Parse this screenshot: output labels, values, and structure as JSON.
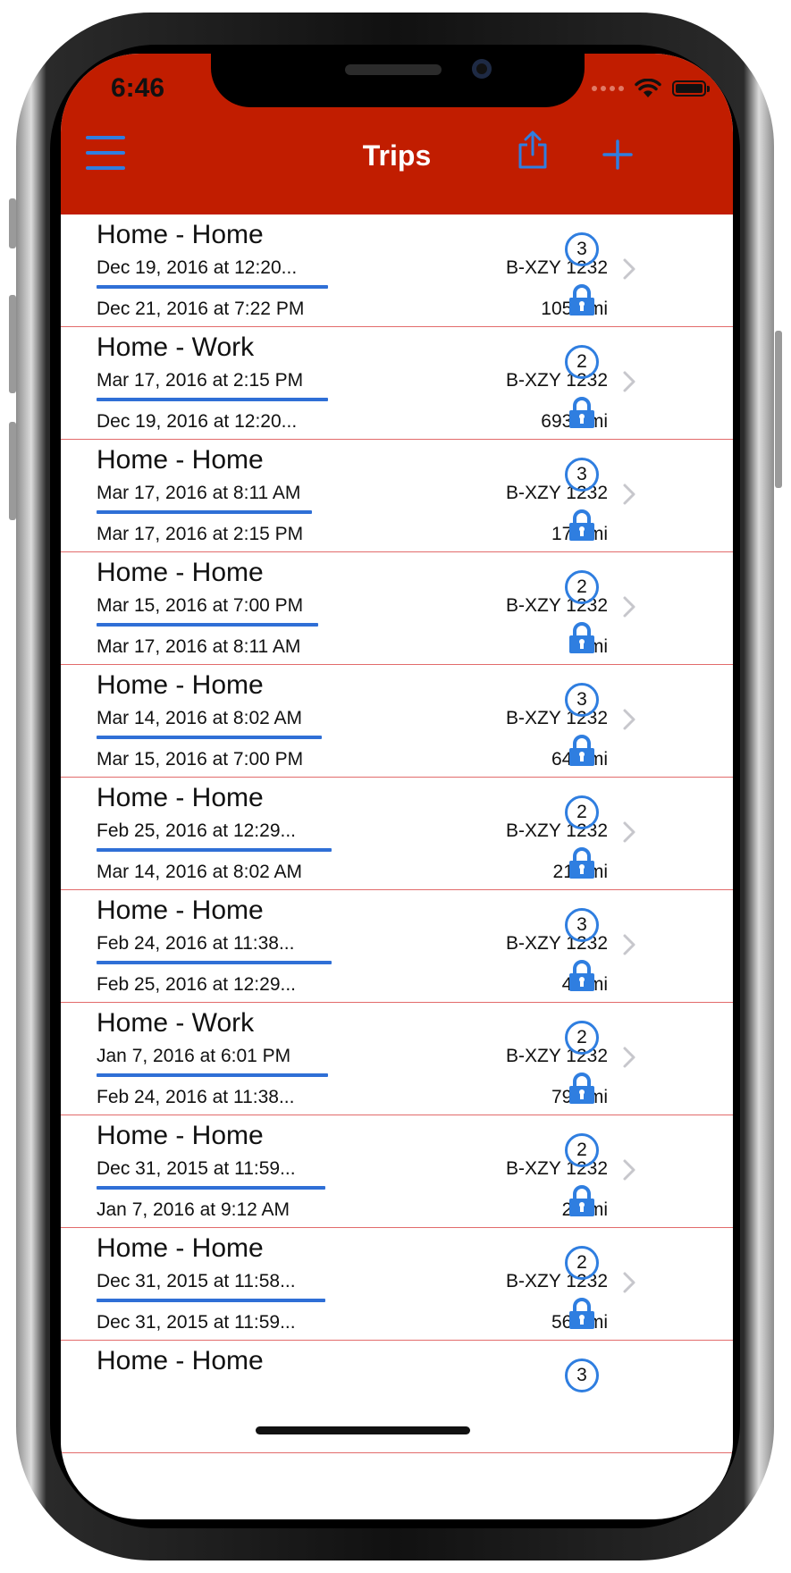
{
  "status_bar": {
    "time": "6:46"
  },
  "nav": {
    "title": "Trips",
    "menu_icon": "hamburger-icon",
    "share_icon": "share-icon",
    "add_icon": "plus-icon"
  },
  "colors": {
    "header": "#c11d00",
    "accent": "#2f7ee0",
    "divider": "#e26b6b"
  },
  "trips": [
    {
      "title": "Home - Home",
      "start": "Dec 19, 2016 at 12:20...",
      "end": "Dec 21, 2016 at 7:22 PM",
      "plate": "B-XZY 1232",
      "distance": "1054 mi",
      "count": "3",
      "progress": 0.72
    },
    {
      "title": "Home - Work",
      "start": "Mar 17, 2016 at 2:15 PM",
      "end": "Dec 19, 2016 at 12:20...",
      "plate": "B-XZY 1232",
      "distance": "6931 mi",
      "count": "2",
      "progress": 0.72
    },
    {
      "title": "Home - Home",
      "start": "Mar 17, 2016 at 8:11 AM",
      "end": "Mar 17, 2016 at 2:15 PM",
      "plate": "B-XZY 1232",
      "distance": "173 mi",
      "count": "3",
      "progress": 0.67
    },
    {
      "title": "Home - Home",
      "start": "Mar 15, 2016 at 7:00 PM",
      "end": "Mar 17, 2016 at 8:11 AM",
      "plate": "B-XZY 1232",
      "distance": "3 mi",
      "count": "2",
      "progress": 0.69
    },
    {
      "title": "Home - Home",
      "start": "Mar 14, 2016 at 8:02 AM",
      "end": "Mar 15, 2016 at 7:00 PM",
      "plate": "B-XZY 1232",
      "distance": "648 mi",
      "count": "3",
      "progress": 0.7
    },
    {
      "title": "Home - Home",
      "start": "Feb 25, 2016 at 12:29...",
      "end": "Mar 14, 2016 at 8:02 AM",
      "plate": "B-XZY 1232",
      "distance": "211 mi",
      "count": "2",
      "progress": 0.73
    },
    {
      "title": "Home - Home",
      "start": "Feb 24, 2016 at 11:38...",
      "end": "Feb 25, 2016 at 12:29...",
      "plate": "B-XZY 1232",
      "distance": "47 mi",
      "count": "3",
      "progress": 0.73
    },
    {
      "title": "Home - Work",
      "start": "Jan 7, 2016 at 6:01 PM",
      "end": "Feb 24, 2016 at 11:38...",
      "plate": "B-XZY 1232",
      "distance": "797 mi",
      "count": "2",
      "progress": 0.72
    },
    {
      "title": "Home - Home",
      "start": "Dec 31, 2015 at 11:59...",
      "end": "Jan 7, 2016 at 9:12 AM",
      "plate": "B-XZY 1232",
      "distance": "27 mi",
      "count": "2",
      "progress": 0.71
    },
    {
      "title": "Home - Home",
      "start": "Dec 31, 2015 at 11:58...",
      "end": "Dec 31, 2015 at 11:59...",
      "plate": "B-XZY 1232",
      "distance": "561 mi",
      "count": "2",
      "progress": 0.71
    },
    {
      "title": "Home - Home",
      "start": "",
      "end": "",
      "plate": "",
      "distance": "",
      "count": "3",
      "progress": 0
    }
  ]
}
